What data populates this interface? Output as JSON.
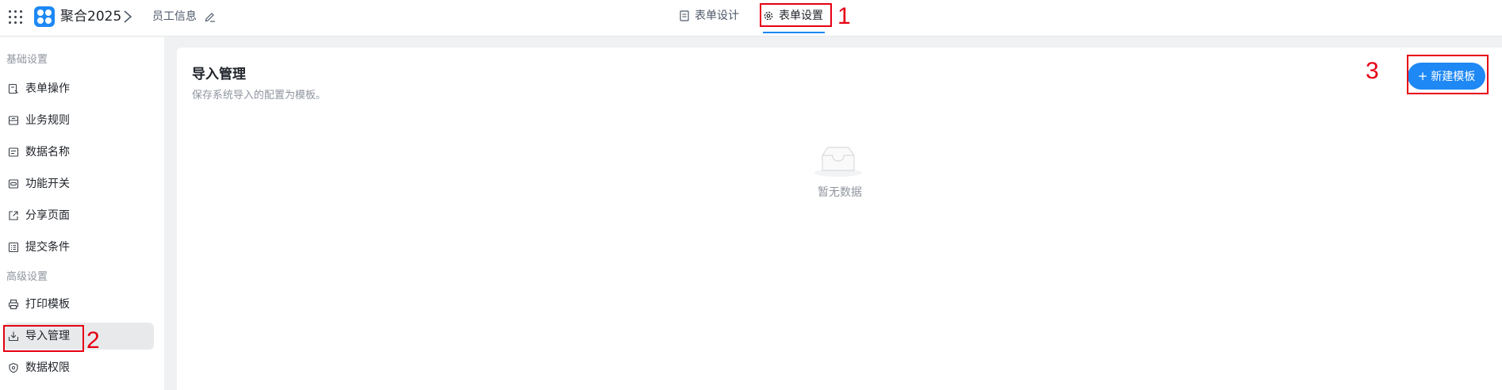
{
  "header": {
    "app_name": "聚合2025",
    "form_name": "员工信息",
    "tabs": [
      {
        "label": "表单设计",
        "icon": "document-icon",
        "active": false
      },
      {
        "label": "表单设置",
        "icon": "gear-icon",
        "active": true
      }
    ]
  },
  "sidebar": {
    "basic_title": "基础设置",
    "basic_items": [
      {
        "label": "表单操作",
        "icon": "form-action-icon"
      },
      {
        "label": "业务规则",
        "icon": "rule-icon"
      },
      {
        "label": "数据名称",
        "icon": "data-name-icon"
      },
      {
        "label": "功能开关",
        "icon": "toggle-icon"
      },
      {
        "label": "分享页面",
        "icon": "share-icon"
      },
      {
        "label": "提交条件",
        "icon": "checklist-icon"
      }
    ],
    "advanced_title": "高级设置",
    "advanced_items": [
      {
        "label": "打印模板",
        "icon": "printer-icon"
      },
      {
        "label": "导入管理",
        "icon": "import-icon",
        "active": true
      },
      {
        "label": "数据权限",
        "icon": "shield-icon"
      }
    ]
  },
  "main": {
    "title": "导入管理",
    "description": "保存系统导入的配置为模板。",
    "new_button": {
      "plus": "+",
      "label": "新建模板"
    },
    "empty_text": "暂无数据"
  },
  "annotations": [
    "1",
    "2",
    "3"
  ],
  "colors": {
    "accent": "#1e88f5",
    "annotation": "#e60012",
    "active_item_bg": "#e8e9eb"
  }
}
